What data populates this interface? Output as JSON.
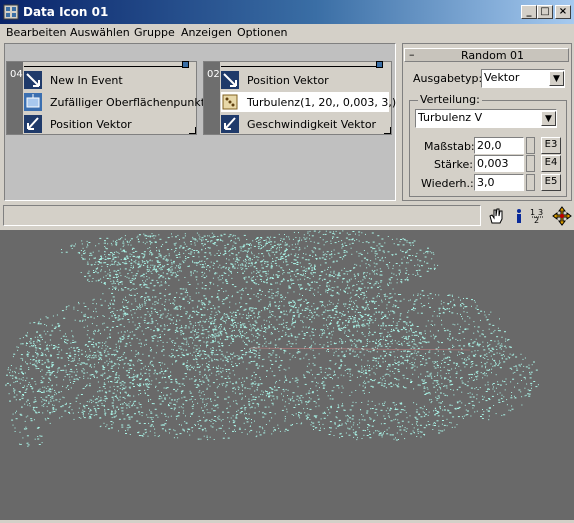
{
  "window": {
    "title": "Data Icon 01",
    "min": "_",
    "max": "□",
    "close": "×"
  },
  "menu": [
    "Bearbeiten",
    "Auswählen",
    "Gruppe",
    "Anzeigen",
    "Optionen"
  ],
  "graph": {
    "node1": {
      "id": "04",
      "rows": [
        "New In Event",
        "Zufälliger Oberflächenpunkt",
        "Position Vektor"
      ]
    },
    "node2": {
      "id": "02",
      "rows": [
        "Position Vektor",
        "Turbulenz(1, 20,, 0,003, 3,)",
        "Geschwindigkeit Vektor"
      ],
      "selected_row": 1
    }
  },
  "panel": {
    "rollout_title": "Random 01",
    "collapse": "–",
    "output_type_label": "Ausgabetyp:",
    "output_type_value": "Vektor",
    "distribution_label": "Verteilung:",
    "distribution_value": "Turbulenz V",
    "params": [
      {
        "label": "Maßstab:",
        "value": "20,0",
        "button": "E3"
      },
      {
        "label": "Stärke:",
        "value": "0,003",
        "button": "E4"
      },
      {
        "label": "Wiederh.:",
        "value": "3,0",
        "button": "E5"
      }
    ]
  },
  "status_bar": {
    "text": ""
  },
  "toolbar_icons": [
    "pan-hand-icon",
    "info-icon",
    "number-layout-icon",
    "move-crosshair-icon"
  ],
  "viewport": {
    "background": "#696969",
    "particle_color": "#aaf5e8"
  }
}
